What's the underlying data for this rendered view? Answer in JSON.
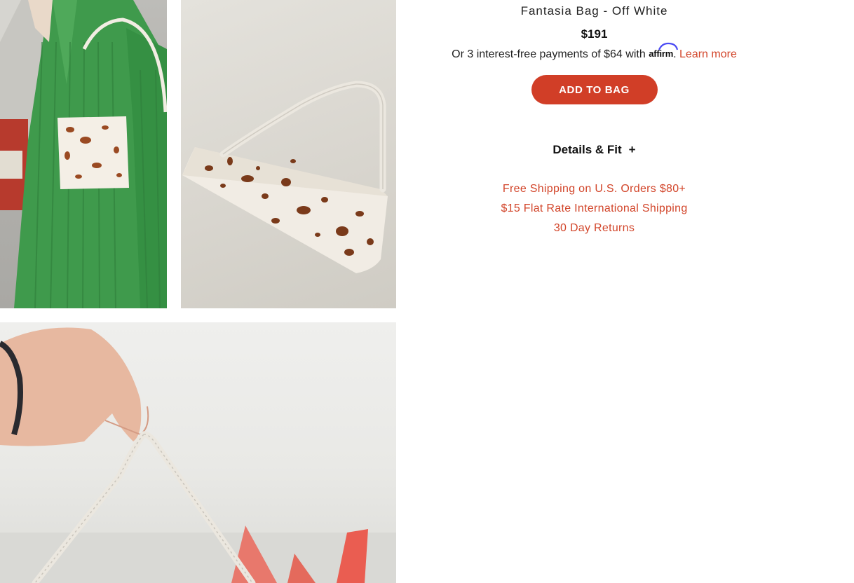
{
  "product": {
    "title": "Fantasia Bag - Off White",
    "price": "$191",
    "affirm": {
      "prefix": "Or 3 interest-free payments of $64 with",
      "brand": "affirm",
      "period": ".",
      "learn_more": "Learn more"
    },
    "add_to_bag": "ADD TO BAG",
    "details_label": "Details & Fit",
    "details_toggle": "+",
    "perks": [
      "Free Shipping on U.S. Orders $80+",
      "$15 Flat Rate International Shipping",
      "30 Day Returns"
    ]
  },
  "colors": {
    "accent": "#d13e27",
    "link": "#d2452a",
    "text": "#111111"
  },
  "gallery": [
    {
      "subject": "model wearing green ribbed dress with spotted shoulder bag"
    },
    {
      "subject": "spotted pony-hair shoulder bag"
    },
    {
      "subject": "hand holding bag strap"
    }
  ]
}
